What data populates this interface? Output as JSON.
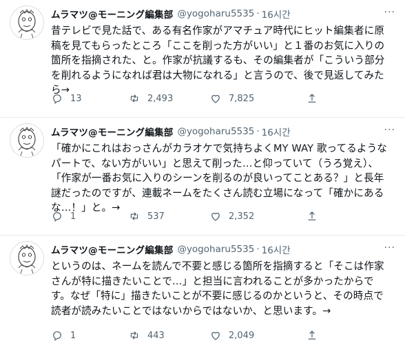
{
  "tweets": [
    {
      "author": "ムラマツ@モーニング編集部",
      "handle": "@yogoharu5535",
      "time": "16시간",
      "text": "昔テレビで見た話で、ある有名作家がアマチュア時代にヒット編集者に原\n稿を見てもらったところ「ここを削った方がいい」と１番のお気に入りの\n箇所を指摘された、と。作家が抗議するも、その編集者が「こういう部分\nを削れるようになれば君は大物になれる」と言うので、後で見返してみた\nら→",
      "replies": "13",
      "retweets": "2,493",
      "likes": "7,825"
    },
    {
      "author": "ムラマツ@モーニング編集部",
      "handle": "@yogoharu5535",
      "time": "16시간",
      "text": "「確かにこれはおっさんがカラオケで気持ちよくMY WAY 歌ってるような\nパートで、ない方がいい」と思えて削った…と仰っていて（うろ覚え）、\n「作家が一番お気に入りのシーンを削るのが良いってことある？」と長年\n謎だったのですが、連載ネームをたくさん読む立場になって「確かにある\nな…！」と。→",
      "replies": "1",
      "retweets": "537",
      "likes": "2,352"
    },
    {
      "author": "ムラマツ@モーニング編集部",
      "handle": "@yogoharu5535",
      "time": "16시간",
      "text": "というのは、ネームを読んで不要と感じる箇所を指摘すると「そこは作家\nさんが特に描きたいことで…」と担当に言われることが多かったからで\nす。なぜ「特に」描きたいことが不要に感じるのかというと、その時点で\n読者が読みたいことではないからではないか、と思います。→",
      "replies": "1",
      "retweets": "443",
      "likes": "2,049"
    }
  ],
  "icons": [
    "reply-icon",
    "retweet-icon",
    "like-icon",
    "share-icon",
    "more-icon"
  ],
  "colors": {
    "text": "#0f1419",
    "secondary": "#536471",
    "divider": "#e6ecf0"
  }
}
